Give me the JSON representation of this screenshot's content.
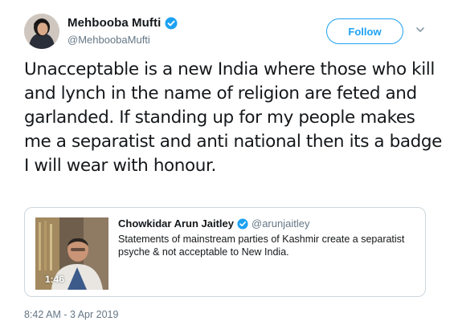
{
  "author": {
    "display_name": "Mehbooba Mufti",
    "handle": "@MehboobaMufti",
    "verified": true,
    "avatar_icon": "avatar-photo"
  },
  "actions": {
    "follow_label": "Follow",
    "menu_icon": "chevron-down-icon"
  },
  "tweet": {
    "text": "Unacceptable is a new India where those who kill and lynch in the name of religion are feted and garlanded. If standing up for my people makes me a separatist and anti national then its a badge I will wear with honour.",
    "timestamp": "8:42 AM - 3 Apr 2019"
  },
  "quoted_tweet": {
    "display_name": "Chowkidar Arun Jaitley",
    "handle": "@arunjaitley",
    "verified": true,
    "text": "Statements of mainstream parties of Kashmir create a separatist psyche & not acceptable to New India.",
    "media_duration": "1:46"
  },
  "colors": {
    "accent": "#1da1f2",
    "muted": "#657786",
    "text": "#14171a",
    "border": "#ccd6dd"
  }
}
